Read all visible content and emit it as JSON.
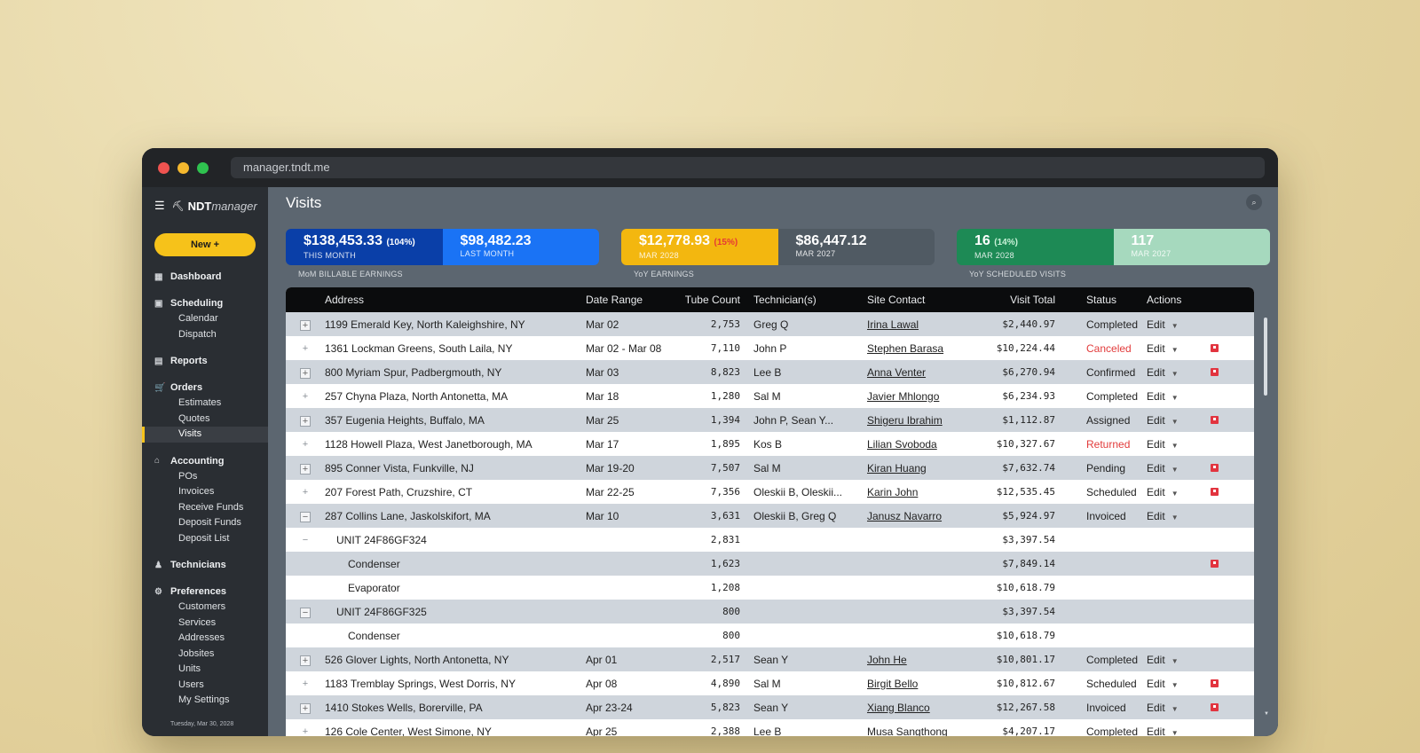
{
  "browser": {
    "url": "manager.tndt.me"
  },
  "sidebar": {
    "brand_bold": "NDT",
    "brand_italic": "manager",
    "new_button": "New +",
    "groups": [
      {
        "label": "Dashboard",
        "icon": "dashboard-icon",
        "items": []
      },
      {
        "label": "Scheduling",
        "icon": "calendar-icon",
        "items": [
          "Calendar",
          "Dispatch"
        ]
      },
      {
        "label": "Reports",
        "icon": "document-icon",
        "items": []
      },
      {
        "label": "Orders",
        "icon": "cart-icon",
        "items": [
          "Estimates",
          "Quotes",
          "Visits"
        ]
      },
      {
        "label": "Accounting",
        "icon": "bank-icon",
        "items": [
          "POs",
          "Invoices",
          "Receive Funds",
          "Deposit Funds",
          "Deposit List"
        ]
      },
      {
        "label": "Technicians",
        "icon": "person-icon",
        "items": []
      },
      {
        "label": "Preferences",
        "icon": "gear-icon",
        "items": [
          "Customers",
          "Services",
          "Addresses",
          "Jobsites",
          "Units",
          "Users",
          "My Settings"
        ]
      }
    ],
    "active_item": "Visits",
    "date": "Tuesday, Mar 30, 2028"
  },
  "page": {
    "title": "Visits"
  },
  "stats": [
    {
      "caption": "MoM BILLABLE EARNINGS",
      "left": {
        "value": "$138,453.33",
        "pct": "(104%)",
        "label": "THIS MONTH",
        "bg": "#0a3fa8",
        "pct_color": "#ffffff"
      },
      "right": {
        "value": "$98,482.23",
        "label": "LAST MONTH",
        "bg": "#1a73f5"
      }
    },
    {
      "caption": "YoY EARNINGS",
      "left": {
        "value": "$12,778.93",
        "pct": "(15%)",
        "label": "MAR 2028",
        "bg": "#f3b70f",
        "pct_color": "#e53935"
      },
      "right": {
        "value": "$86,447.12",
        "label": "MAR 2027",
        "bg": "#505a63"
      }
    },
    {
      "caption": "YoY SCHEDULED VISITS",
      "left": {
        "value": "16",
        "pct": "(14%)",
        "label": "MAR 2028",
        "bg": "#1d8a55",
        "pct_color": "#c8f2d8"
      },
      "right": {
        "value": "117",
        "label": "MAR 2027",
        "bg": "#a6d9be"
      }
    }
  ],
  "table": {
    "headers": [
      "Address",
      "Date Range",
      "Tube Count",
      "Technician(s)",
      "Site Contact",
      "Visit Total",
      "Status",
      "Actions"
    ],
    "action_label": "Edit",
    "rows": [
      {
        "tog": "+",
        "tog_style": "box",
        "level": 0,
        "address": "1199 Emerald Key, North Kaleighshire, NY",
        "date": "Mar 02",
        "tubes": "2,753",
        "tech": "Greg Q",
        "contact": "Irina Lawal",
        "total": "$2,440.97",
        "status": "Completed",
        "status_red": false,
        "flag": false,
        "edit": true
      },
      {
        "tog": "+",
        "tog_style": "plain",
        "level": 0,
        "address": "1361 Lockman Greens, South Laila, NY",
        "date": "Mar 02 - Mar 08",
        "tubes": "7,110",
        "tech": "John P",
        "contact": "Stephen Barasa",
        "total": "$10,224.44",
        "status": "Canceled",
        "status_red": true,
        "flag": true,
        "edit": true
      },
      {
        "tog": "+",
        "tog_style": "box",
        "level": 0,
        "address": "800 Myriam Spur, Padbergmouth, NY",
        "date": "Mar 03",
        "tubes": "8,823",
        "tech": "Lee B",
        "contact": "Anna Venter",
        "total": "$6,270.94",
        "status": "Confirmed",
        "status_red": false,
        "flag": true,
        "edit": true
      },
      {
        "tog": "+",
        "tog_style": "plain",
        "level": 0,
        "address": "257 Chyna Plaza, North Antonetta, MA",
        "date": "Mar 18",
        "tubes": "1,280",
        "tech": "Sal M",
        "contact": "Javier Mhlongo",
        "total": "$6,234.93",
        "status": "Completed",
        "status_red": false,
        "flag": false,
        "edit": true
      },
      {
        "tog": "+",
        "tog_style": "box",
        "level": 0,
        "address": "357 Eugenia Heights, Buffalo, MA",
        "date": "Mar 25",
        "tubes": "1,394",
        "tech": "John P, Sean Y...",
        "contact": "Shigeru Ibrahim",
        "total": "$1,112.87",
        "status": "Assigned",
        "status_red": false,
        "flag": true,
        "edit": true
      },
      {
        "tog": "+",
        "tog_style": "plain",
        "level": 0,
        "address": "1128 Howell Plaza, West Janetborough, MA",
        "date": "Mar 17",
        "tubes": "1,895",
        "tech": "Kos B",
        "contact": "Lilian Svoboda",
        "total": "$10,327.67",
        "status": "Returned",
        "status_red": true,
        "flag": false,
        "edit": true
      },
      {
        "tog": "+",
        "tog_style": "box",
        "level": 0,
        "address": "895 Conner Vista, Funkville, NJ",
        "date": "Mar 19-20",
        "tubes": "7,507",
        "tech": "Sal M",
        "contact": "Kiran Huang",
        "total": "$7,632.74",
        "status": "Pending",
        "status_red": false,
        "flag": true,
        "edit": true
      },
      {
        "tog": "+",
        "tog_style": "plain",
        "level": 0,
        "address": "207 Forest Path, Cruzshire, CT",
        "date": "Mar 22-25",
        "tubes": "7,356",
        "tech": "Oleskii B, Oleskii...",
        "contact": "Karin John",
        "total": "$12,535.45",
        "status": "Scheduled",
        "status_red": false,
        "flag": true,
        "edit": true
      },
      {
        "tog": "−",
        "tog_style": "box",
        "level": 0,
        "address": "287 Collins Lane, Jaskolskifort, MA",
        "date": "Mar 10",
        "tubes": "3,631",
        "tech": "Oleskii B, Greg Q",
        "contact": "Janusz Navarro",
        "total": "$5,924.97",
        "status": "Invoiced",
        "status_red": false,
        "flag": false,
        "edit": true
      },
      {
        "tog": "−",
        "tog_style": "plain",
        "level": 1,
        "address": "UNIT 24F86GF324",
        "date": "",
        "tubes": "2,831",
        "tech": "",
        "contact": "",
        "total": "$3,397.54",
        "status": "",
        "status_red": false,
        "flag": false,
        "edit": false
      },
      {
        "tog": "",
        "tog_style": "plain",
        "level": 2,
        "address": "Condenser",
        "date": "",
        "tubes": "1,623",
        "tech": "",
        "contact": "",
        "total": "$7,849.14",
        "status": "",
        "status_red": false,
        "flag": true,
        "edit": false
      },
      {
        "tog": "",
        "tog_style": "plain",
        "level": 2,
        "address": "Evaporator",
        "date": "",
        "tubes": "1,208",
        "tech": "",
        "contact": "",
        "total": "$10,618.79",
        "status": "",
        "status_red": false,
        "flag": false,
        "edit": false
      },
      {
        "tog": "−",
        "tog_style": "box",
        "level": 1,
        "address": "UNIT 24F86GF325",
        "date": "",
        "tubes": "800",
        "tech": "",
        "contact": "",
        "total": "$3,397.54",
        "status": "",
        "status_red": false,
        "flag": false,
        "edit": false
      },
      {
        "tog": "",
        "tog_style": "plain",
        "level": 2,
        "address": "Condenser",
        "date": "",
        "tubes": "800",
        "tech": "",
        "contact": "",
        "total": "$10,618.79",
        "status": "",
        "status_red": false,
        "flag": false,
        "edit": false
      },
      {
        "tog": "+",
        "tog_style": "box",
        "level": 0,
        "address": "526 Glover Lights, North Antonetta, NY",
        "date": "Apr 01",
        "tubes": "2,517",
        "tech": "Sean Y",
        "contact": "John He",
        "total": "$10,801.17",
        "status": "Completed",
        "status_red": false,
        "flag": false,
        "edit": true
      },
      {
        "tog": "+",
        "tog_style": "plain",
        "level": 0,
        "address": "1183 Tremblay Springs, West Dorris, NY",
        "date": "Apr 08",
        "tubes": "4,890",
        "tech": "Sal M",
        "contact": "Birgit Bello",
        "total": "$10,812.67",
        "status": "Scheduled",
        "status_red": false,
        "flag": true,
        "edit": true
      },
      {
        "tog": "+",
        "tog_style": "box",
        "level": 0,
        "address": "1410 Stokes Wells, Borerville, PA",
        "date": "Apr 23-24",
        "tubes": "5,823",
        "tech": "Sean Y",
        "contact": "Xiang Blanco",
        "total": "$12,267.58",
        "status": "Invoiced",
        "status_red": false,
        "flag": true,
        "edit": true
      },
      {
        "tog": "+",
        "tog_style": "plain",
        "level": 0,
        "address": "126 Cole Center, West Simone, NY",
        "date": "Apr 25",
        "tubes": "2,388",
        "tech": "Lee B",
        "contact": "Musa Sangthong",
        "total": "$4,207.17",
        "status": "Completed",
        "status_red": false,
        "flag": false,
        "edit": true
      }
    ]
  }
}
